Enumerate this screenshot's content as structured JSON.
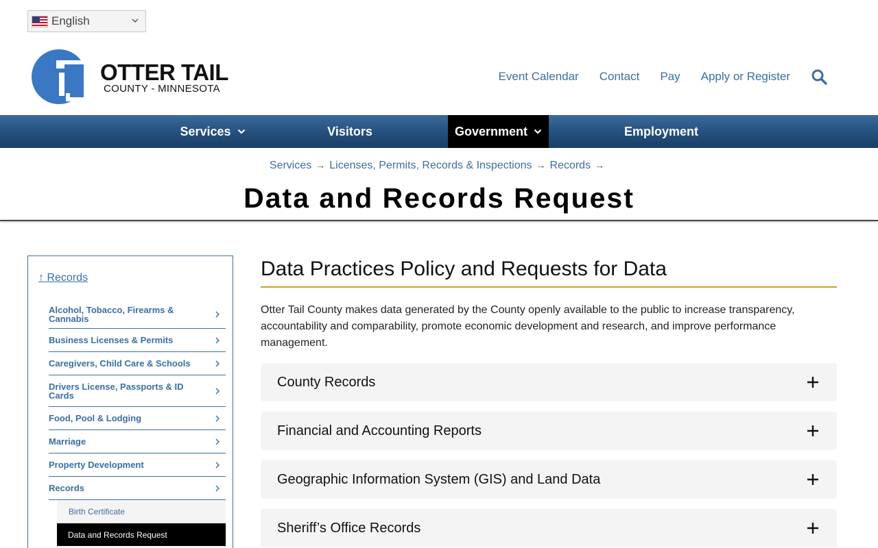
{
  "language": {
    "selected": "English"
  },
  "logo": {
    "name": "OTTER TAIL",
    "sub": "COUNTY - MINNESOTA"
  },
  "utility_nav": [
    "Event Calendar",
    "Contact",
    "Pay",
    "Apply or Register"
  ],
  "main_nav": {
    "services": "Services",
    "visitors": "Visitors",
    "government": "Government",
    "employment": "Employment"
  },
  "breadcrumb": [
    "Services",
    "Licenses, Permits, Records & Inspections",
    "Records"
  ],
  "breadcrumb_separator": "→",
  "page_title": "Data and Records Request",
  "sidebar": {
    "parent": "↑ Records",
    "items": [
      "Alcohol, Tobacco, Firearms & Cannabis",
      "Business Licenses & Permits",
      "Caregivers, Child Care & Schools",
      "Drivers License, Passports & ID Cards",
      "Food, Pool & Lodging",
      "Marriage",
      "Property Development",
      "Records"
    ],
    "sub_items": [
      "Birth Certificate",
      "Data and Records Request"
    ]
  },
  "content": {
    "heading": "Data Practices Policy and Requests for Data",
    "intro": "Otter Tail County makes data generated by the County openly available to the public to increase transparency, accountability and comparability, promote economic development and research, and improve performance management.",
    "accordions": [
      "County Records",
      "Financial and Accounting Reports",
      "Geographic Information System (GIS) and Land Data",
      "Sheriff’s Office Records"
    ]
  },
  "colors": {
    "link": "#3a6ea5",
    "nav_bar": "#244f7c",
    "accent_rule": "#c9a227",
    "active": "#000000"
  }
}
